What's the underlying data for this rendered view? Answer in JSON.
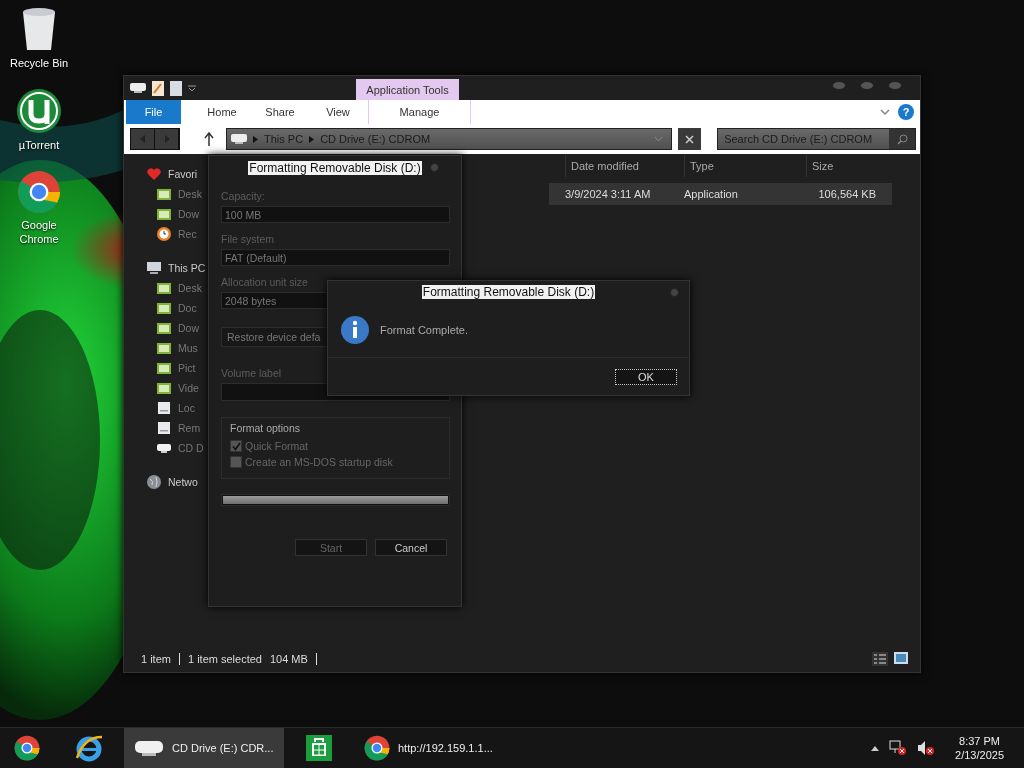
{
  "desktop_icons": [
    {
      "label": "Recycle Bin",
      "kind": "recycle"
    },
    {
      "label": "µTorrent",
      "kind": "torrent"
    },
    {
      "label": "Google Chrome",
      "kind": "chrome"
    }
  ],
  "explorer": {
    "contextual_tab": "Application Tools",
    "ribbon_tabs": [
      {
        "label": "File",
        "kind": "file"
      },
      {
        "label": "Home",
        "kind": "tab"
      },
      {
        "label": "Share",
        "kind": "tab"
      },
      {
        "label": "View",
        "kind": "tab"
      },
      {
        "label": "Manage",
        "kind": "contextual"
      }
    ],
    "help": "?",
    "breadcrumb": [
      "This PC",
      "CD Drive (E:) CDROM"
    ],
    "search": {
      "placeholder": "Search CD Drive (E:) CDROM"
    },
    "sidebar": [
      {
        "label": "Favori",
        "kind": "favorites",
        "children": [
          {
            "label": "Desk",
            "kind": "folder"
          },
          {
            "label": "Dow",
            "kind": "folder"
          },
          {
            "label": "Rec",
            "kind": "recent"
          }
        ]
      },
      {
        "label": "This PC",
        "kind": "pc",
        "children": [
          {
            "label": "Desk",
            "kind": "folder"
          },
          {
            "label": "Doc",
            "kind": "folder"
          },
          {
            "label": "Dow",
            "kind": "folder"
          },
          {
            "label": "Mus",
            "kind": "folder"
          },
          {
            "label": "Pict",
            "kind": "folder"
          },
          {
            "label": "Vide",
            "kind": "folder"
          },
          {
            "label": "Loc",
            "kind": "disk"
          },
          {
            "label": "Rem",
            "kind": "disk"
          },
          {
            "label": "CD D",
            "kind": "cd"
          }
        ]
      },
      {
        "label": "Netwo",
        "kind": "network"
      }
    ],
    "columns": [
      "Date modified",
      "Type",
      "Size"
    ],
    "rows": [
      {
        "selected": true,
        "cells": [
          "3/9/2024 3:11 AM",
          "Application",
          "106,564 KB"
        ]
      }
    ],
    "status_bar": {
      "item_count": "1 item",
      "selection": "1 item selected",
      "selection_size": "104 MB"
    }
  },
  "format_dialog": {
    "title": "Formatting Removable Disk (D:)",
    "fields": [
      {
        "label": "Capacity:",
        "value": "100 MB"
      },
      {
        "label": "File system",
        "value": "FAT (Default)"
      },
      {
        "label": "Allocation unit size",
        "value": "2048 bytes"
      }
    ],
    "restore_button": "Restore device defa",
    "volume_label": "Volume label",
    "options_title": "Format options",
    "options": [
      {
        "label": "Quick Format",
        "checked": true
      },
      {
        "label": "Create an MS-DOS startup disk",
        "checked": false
      }
    ],
    "progress": {
      "level": 1
    },
    "buttons": [
      {
        "label": "Start",
        "disabled": true
      },
      {
        "label": "Cancel",
        "disabled": false
      }
    ]
  },
  "message_box": {
    "title": "Formatting Removable Disk (D:)",
    "message": "Format Complete.",
    "button": "OK"
  },
  "taskbar": {
    "items": [
      {
        "kind": "chrome",
        "selected": false
      },
      {
        "kind": "ie",
        "selected": false
      },
      {
        "kind": "drive",
        "label": "CD Drive (E:) CDR...",
        "selected": true
      },
      {
        "kind": "store",
        "selected": false
      },
      {
        "kind": "chrome",
        "label": "http://192.159.1.1...",
        "selected": false
      }
    ],
    "time": "8:37 PM",
    "date": "2/13/2025"
  }
}
